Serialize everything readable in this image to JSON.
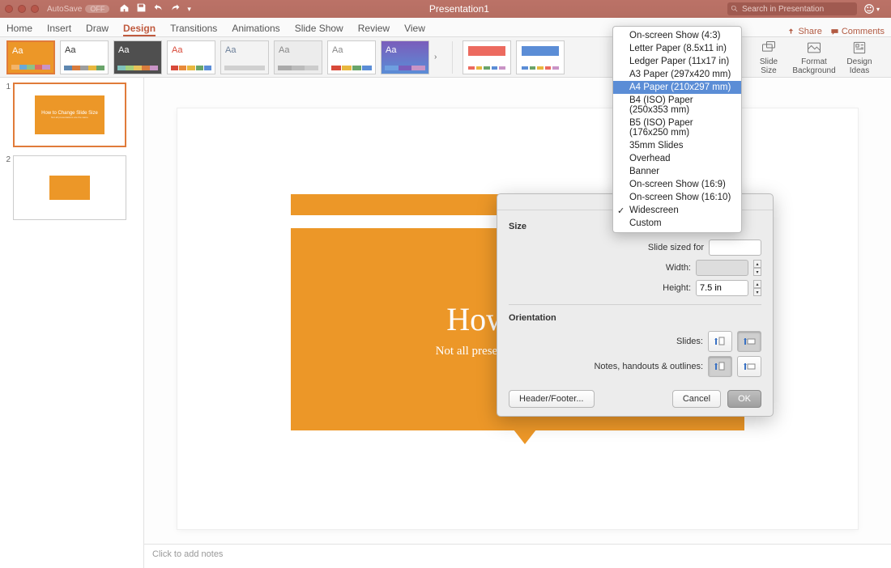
{
  "titlebar": {
    "autosave_label": "AutoSave",
    "autosave_state": "OFF",
    "title": "Presentation1",
    "search_placeholder": "Search in Presentation"
  },
  "ribbon_tabs": [
    "Home",
    "Insert",
    "Draw",
    "Design",
    "Transitions",
    "Animations",
    "Slide Show",
    "Review",
    "View"
  ],
  "ribbon_active_tab": "Design",
  "share_label": "Share",
  "comments_label": "Comments",
  "tools": {
    "slide_size": "Slide\nSize",
    "format_background": "Format\nBackground",
    "design_ideas": "Design\nIdeas"
  },
  "thumbnails": [
    {
      "num": "1",
      "title": "How to Change Slide Size",
      "subtitle": "Not all presentations are the same",
      "selected": true
    },
    {
      "num": "2",
      "title": "",
      "subtitle": "",
      "selected": false
    }
  ],
  "slide": {
    "title": "How to Ch",
    "subtitle": "Not all presentations are the same"
  },
  "notes_placeholder": "Click to add notes",
  "dialog": {
    "section_size": "Size",
    "sized_for_label": "Slide sized for",
    "width_label": "Width:",
    "height_label": "Height:",
    "height_value": "7.5 in",
    "section_orientation": "Orientation",
    "slides_label": "Slides:",
    "notes_label": "Notes, handouts & outlines:",
    "header_footer": "Header/Footer...",
    "cancel": "Cancel",
    "ok": "OK"
  },
  "dropdown": {
    "items": [
      "On-screen Show (4:3)",
      "Letter Paper (8.5x11 in)",
      "Ledger Paper (11x17 in)",
      "A3 Paper (297x420 mm)",
      "A4 Paper (210x297 mm)",
      "B4 (ISO) Paper (250x353 mm)",
      "B5 (ISO) Paper (176x250 mm)",
      "35mm Slides",
      "Overhead",
      "Banner",
      "On-screen Show (16:9)",
      "On-screen Show (16:10)",
      "Widescreen",
      "Custom"
    ],
    "highlighted_index": 4,
    "checked_index": 12
  }
}
